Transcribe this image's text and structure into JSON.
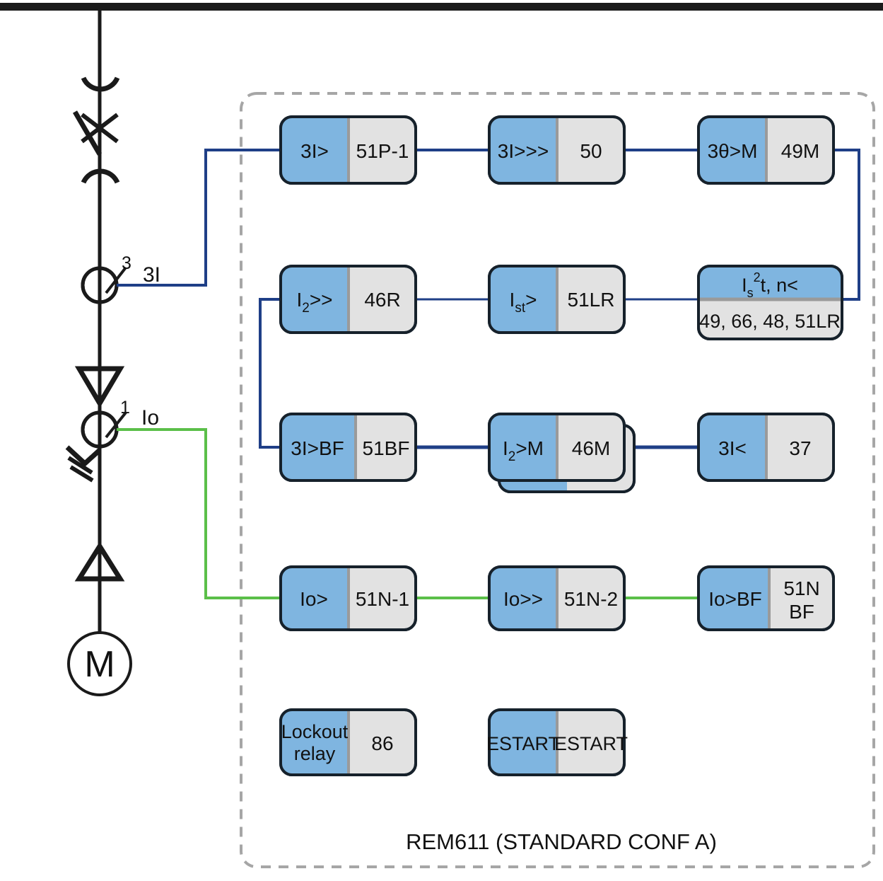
{
  "diagram": {
    "caption": "REM611 (STANDARD CONF A)",
    "relay_enclosure_label": "relay function container"
  },
  "singleline": {
    "busbar": "busbar",
    "breaker": "withdrawable-circuit-breaker",
    "ct_phase": {
      "ratio_label": "3",
      "signal_label": "3I",
      "color": "#1F3F87"
    },
    "ct_earth": {
      "ratio_label": "1",
      "signal_label": "Io",
      "color": "#5BBF49"
    },
    "cable_termination_top": "cable-termination-down",
    "cable_termination_bottom": "cable-termination-up",
    "earth_symbol": "cable-screen-earth",
    "motor": {
      "label": "M"
    }
  },
  "colors": {
    "block_blue": "#7FB5E0",
    "block_gray": "#E2E2E2",
    "block_outline": "#16212B",
    "divider": "#9A9A9A",
    "wire_blue": "#1F3F87",
    "wire_green": "#5BBF49",
    "enclosure_dash": "#A6A6A6",
    "black": "#1A1A1A"
  },
  "rows": [
    {
      "name": "overcurrent-row",
      "wire": "blue",
      "blocks": [
        {
          "id": "b-51p1",
          "left": "3I>",
          "right": "51P-1",
          "style": "split-vertical"
        },
        {
          "id": "b-50",
          "left": "3I>>>",
          "right": "50",
          "style": "split-vertical"
        },
        {
          "id": "b-49m",
          "left": "3θ>M",
          "right": "49M",
          "style": "split-vertical"
        }
      ]
    },
    {
      "name": "unbalance-locked-rotor-row",
      "wire": "blue",
      "blocks": [
        {
          "id": "b-46r",
          "left": "I2>>",
          "left_base": "I",
          "left_sub": "2",
          "left_rest": ">>",
          "right": "46R",
          "style": "split-vertical"
        },
        {
          "id": "b-51lr",
          "left": "Ist>",
          "left_base": "I",
          "left_sub": "st",
          "left_rest": ">",
          "right": "51LR",
          "style": "split-vertical"
        },
        {
          "id": "b-thermal",
          "top": "Is2t, n<",
          "top_base": "I",
          "top_sub": "s",
          "top_sup": "2",
          "top_rest": "t, n<",
          "bottom": "49, 66, 48, 51LR",
          "style": "split-horizontal"
        }
      ]
    },
    {
      "name": "breaker-failure-row",
      "wire": "blue",
      "blocks": [
        {
          "id": "b-51bf",
          "left": "3I>BF",
          "right": "51BF",
          "style": "split-vertical"
        },
        {
          "id": "b-46m",
          "left": "I2>M",
          "left_base": "I",
          "left_sub": "2",
          "left_rest": ">M",
          "right": "46M",
          "style": "split-vertical-stacked"
        },
        {
          "id": "b-37",
          "left": "3I<",
          "right": "37",
          "style": "split-vertical"
        }
      ]
    },
    {
      "name": "earth-fault-row",
      "wire": "green",
      "blocks": [
        {
          "id": "b-51n1",
          "left": "Io>",
          "right": "51N-1",
          "style": "split-vertical"
        },
        {
          "id": "b-51n2",
          "left": "Io>>",
          "right": "51N-2",
          "style": "split-vertical"
        },
        {
          "id": "b-51nbf",
          "left": "Io>BF",
          "right_line1": "51N",
          "right_line2": "BF",
          "style": "split-vertical-twoline"
        }
      ]
    },
    {
      "name": "lockout-restart-row",
      "wire": "none",
      "blocks": [
        {
          "id": "b-86",
          "left_line1": "Lockout",
          "left_line2": "relay",
          "right": "86",
          "style": "split-vertical-twoline-left"
        },
        {
          "id": "b-estart",
          "left": "ESTART",
          "right": "ESTART",
          "style": "split-vertical"
        }
      ]
    }
  ]
}
